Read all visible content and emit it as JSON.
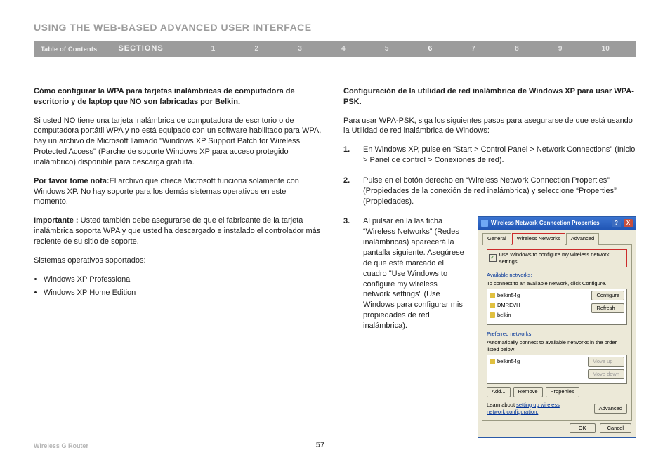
{
  "header": {
    "title": "USING THE WEB-BASED ADVANCED USER INTERFACE",
    "toc": "Table of Contents",
    "sections_label": "SECTIONS",
    "sections": [
      "1",
      "2",
      "3",
      "4",
      "5",
      "6",
      "7",
      "8",
      "9",
      "10"
    ],
    "active": "6"
  },
  "left": {
    "h1": "Cómo configurar la WPA para tarjetas inalámbricas de computadora de escritorio y de laptop que NO son fabricadas por Belkin.",
    "p1": "Si usted NO tiene una tarjeta inalámbrica de computadora de escritorio o de computadora portátil WPA y no está equipado con un software habilitado para WPA, hay un archivo de Microsoft llamado \"Windows XP Support Patch for Wireless Protected Access\" (Parche de soporte Windows XP para acceso protegido inalámbrico) disponible para descarga gratuita.",
    "note_label": "Por favor tome nota:",
    "note_text": "El archivo que ofrece Microsoft funciona solamente con Windows XP. No hay soporte para los demás sistemas operativos en este momento.",
    "imp_label": "Importante :",
    "imp_text": " Usted también debe asegurarse de que el fabricante de la tarjeta inalámbrica soporta WPA y que usted ha descargado e instalado el controlador más reciente de su sitio de soporte.",
    "os_label": "Sistemas operativos soportados:",
    "os": [
      "Windows XP Professional",
      "Windows XP Home Edition"
    ]
  },
  "right": {
    "h1": "Configuración de la utilidad de red inalámbrica de Windows XP para usar WPA-PSK.",
    "intro": "Para usar WPA-PSK, siga los siguientes pasos para asegurarse de que está usando la Utilidad de red inalámbrica de Windows:",
    "steps": {
      "n1": "1.",
      "s1": "En Windows XP, pulse en “Start > Control Panel > Network Connections” (Inicio > Panel de control > Conexiones de red).",
      "n2": "2.",
      "s2": "Pulse en el botón derecho en “Wireless Network Connection Properties” (Propiedades de la conexión de red inalámbrica) y seleccione “Properties” (Propiedades).",
      "n3": "3.",
      "s3": "Al pulsar en la las ficha “Wireless Networks” (Redes inalámbricas) aparecerá la pantalla siguiente. Asegúrese de que esté marcado el cuadro \"Use Windows to configure my wireless network settings\" (Use Windows para configurar mis propiedades de red inalámbrica)."
    }
  },
  "dialog": {
    "title": "Wireless Network Connection Properties",
    "help": "?",
    "close": "X",
    "tabs": {
      "general": "General",
      "wireless": "Wireless Networks",
      "advanced": "Advanced"
    },
    "checkbox": "Use Windows to configure my wireless network settings",
    "check_mark": "✓",
    "available_label": "Available networks:",
    "available_hint": "To connect to an available network, click Configure.",
    "nets": [
      "belkin54g",
      "DMREVH",
      "belkin"
    ],
    "btn_configure": "Configure",
    "btn_refresh": "Refresh",
    "preferred_label": "Preferred networks:",
    "preferred_hint": "Automatically connect to available networks in the order listed below:",
    "pref_nets": [
      "belkin54g"
    ],
    "btn_moveup": "Move up",
    "btn_movedown": "Move down",
    "btn_add": "Add...",
    "btn_remove": "Remove",
    "btn_props": "Properties",
    "learn_prefix": "Learn about ",
    "learn_link": "setting up wireless network configuration.",
    "btn_advanced": "Advanced",
    "btn_ok": "OK",
    "btn_cancel": "Cancel"
  },
  "footer": {
    "product": "Wireless G Router",
    "page": "57"
  }
}
